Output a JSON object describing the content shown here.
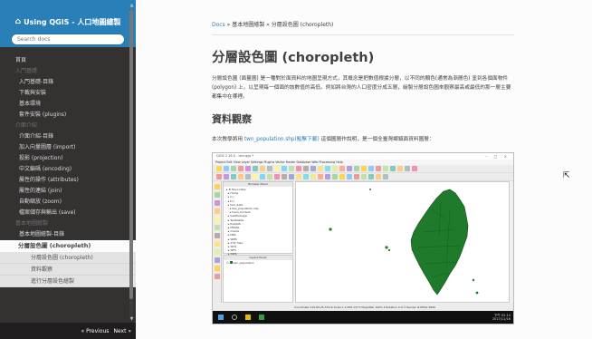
{
  "sidebar": {
    "brand": "Using QGIS - 人口地圖繪製",
    "search_placeholder": "Search docs",
    "items": [
      {
        "kind": "top",
        "label": "首頁"
      },
      {
        "kind": "cap",
        "label": "入門基礎"
      },
      {
        "kind": "item",
        "label": "入門基礎-目錄"
      },
      {
        "kind": "item",
        "label": "下載與安裝"
      },
      {
        "kind": "item",
        "label": "基本環境"
      },
      {
        "kind": "item",
        "label": "套件安裝 (plugins)"
      },
      {
        "kind": "cap",
        "label": "介面介紹"
      },
      {
        "kind": "item",
        "label": "介面介紹-目錄"
      },
      {
        "kind": "item",
        "label": "加入向量圖層 (import)"
      },
      {
        "kind": "item",
        "label": "投影 (projection)"
      },
      {
        "kind": "item",
        "label": "中文編碼 (encoding)"
      },
      {
        "kind": "item",
        "label": "屬性的操作 (attributes)"
      },
      {
        "kind": "item",
        "label": "屬性的連結 (join)"
      },
      {
        "kind": "item",
        "label": "自動縮放 (zoom)"
      },
      {
        "kind": "item",
        "label": "檔案儲存與輸出 (save)"
      },
      {
        "kind": "cap",
        "label": "基本地圖繪製"
      },
      {
        "kind": "item",
        "label": "基本地圖繪製-目錄"
      },
      {
        "kind": "current",
        "label": "分層設色圖 (choropleth)"
      },
      {
        "kind": "sub",
        "label": "分層設色圖 (choropleth)"
      },
      {
        "kind": "sub",
        "label": "資料觀察"
      },
      {
        "kind": "sub",
        "label": "進行分層設色繪製"
      }
    ],
    "pager": {
      "previous": "« Previous",
      "next": "Next »"
    }
  },
  "breadcrumb": {
    "docs": "Docs",
    "trail": " » 基本地圖繪製 » 分層設色圖 (choropleth)"
  },
  "article": {
    "title": "分層設色圖 (choropleth)",
    "intro": "分層設色圖 (面量圖) 是一種對於面資料的地圖呈現方式，其概念是把數值根據分層，以不同的顏色(通常為漸層色) 塗到各個面物件(polygon) 上，以呈現每一個面的該數值的高低。例如將台灣的人口密度分成五層，繪製分層設色圖來觀察最高或最低的那一層主要都集中在哪裡。",
    "section_title": "資料觀察",
    "body_before": "本次教學將用 ",
    "body_link": "twn_population.shp(點擊下載)",
    "body_after": " 這個圖層作說明，是一個全臺灣鄉鎮面資料圖層："
  },
  "screenshot": {
    "title": "QGIS 2.18.0 - twn.qgs *",
    "window_controls": "–  □  ×",
    "menu": "Project  Edit  View  Layer  Settings  Plugins  Vector  Raster  Database  Web  Processing  Help",
    "browser_header": "Browser Panel",
    "browser_items": [
      "▸ ★ Favourites",
      "  ▸ Home",
      "  ▸ C:/",
      "  ▸ D:/",
      "  ▸ twn_data",
      "    ▸ twn_population.shp",
      "    ▸ town_borders",
      "  ▸ GeoPackage",
      "  ▸ SpatiaLite",
      "  ▸ PostGIS",
      "  ▸ MSSQL",
      "  ▸ Oracle",
      "  ▸ DB2",
      "  ▸ WMS",
      "  ▸ XYZ Tiles",
      "  ▸ WCS",
      "  ▸ WFS",
      "  ▸ OWS",
      "  ▸ ArcGisMapServer"
    ],
    "layers_header": "Layers Panel",
    "layer_name": "twn_population",
    "status": "Coordinate  119.84,25.379  ⊕  Scale  1:2,455,147  ▾  Magnifier  100%  ▾  Rotation  0.0  ☑ Render  ⊕ EPSG:3826",
    "clock_time": "下午 02:14",
    "clock_date": "2017/11/16"
  },
  "colors": {
    "accent": "#2980b9",
    "sidebar_bg": "#343131",
    "map_fill": "#1f7a2c"
  }
}
